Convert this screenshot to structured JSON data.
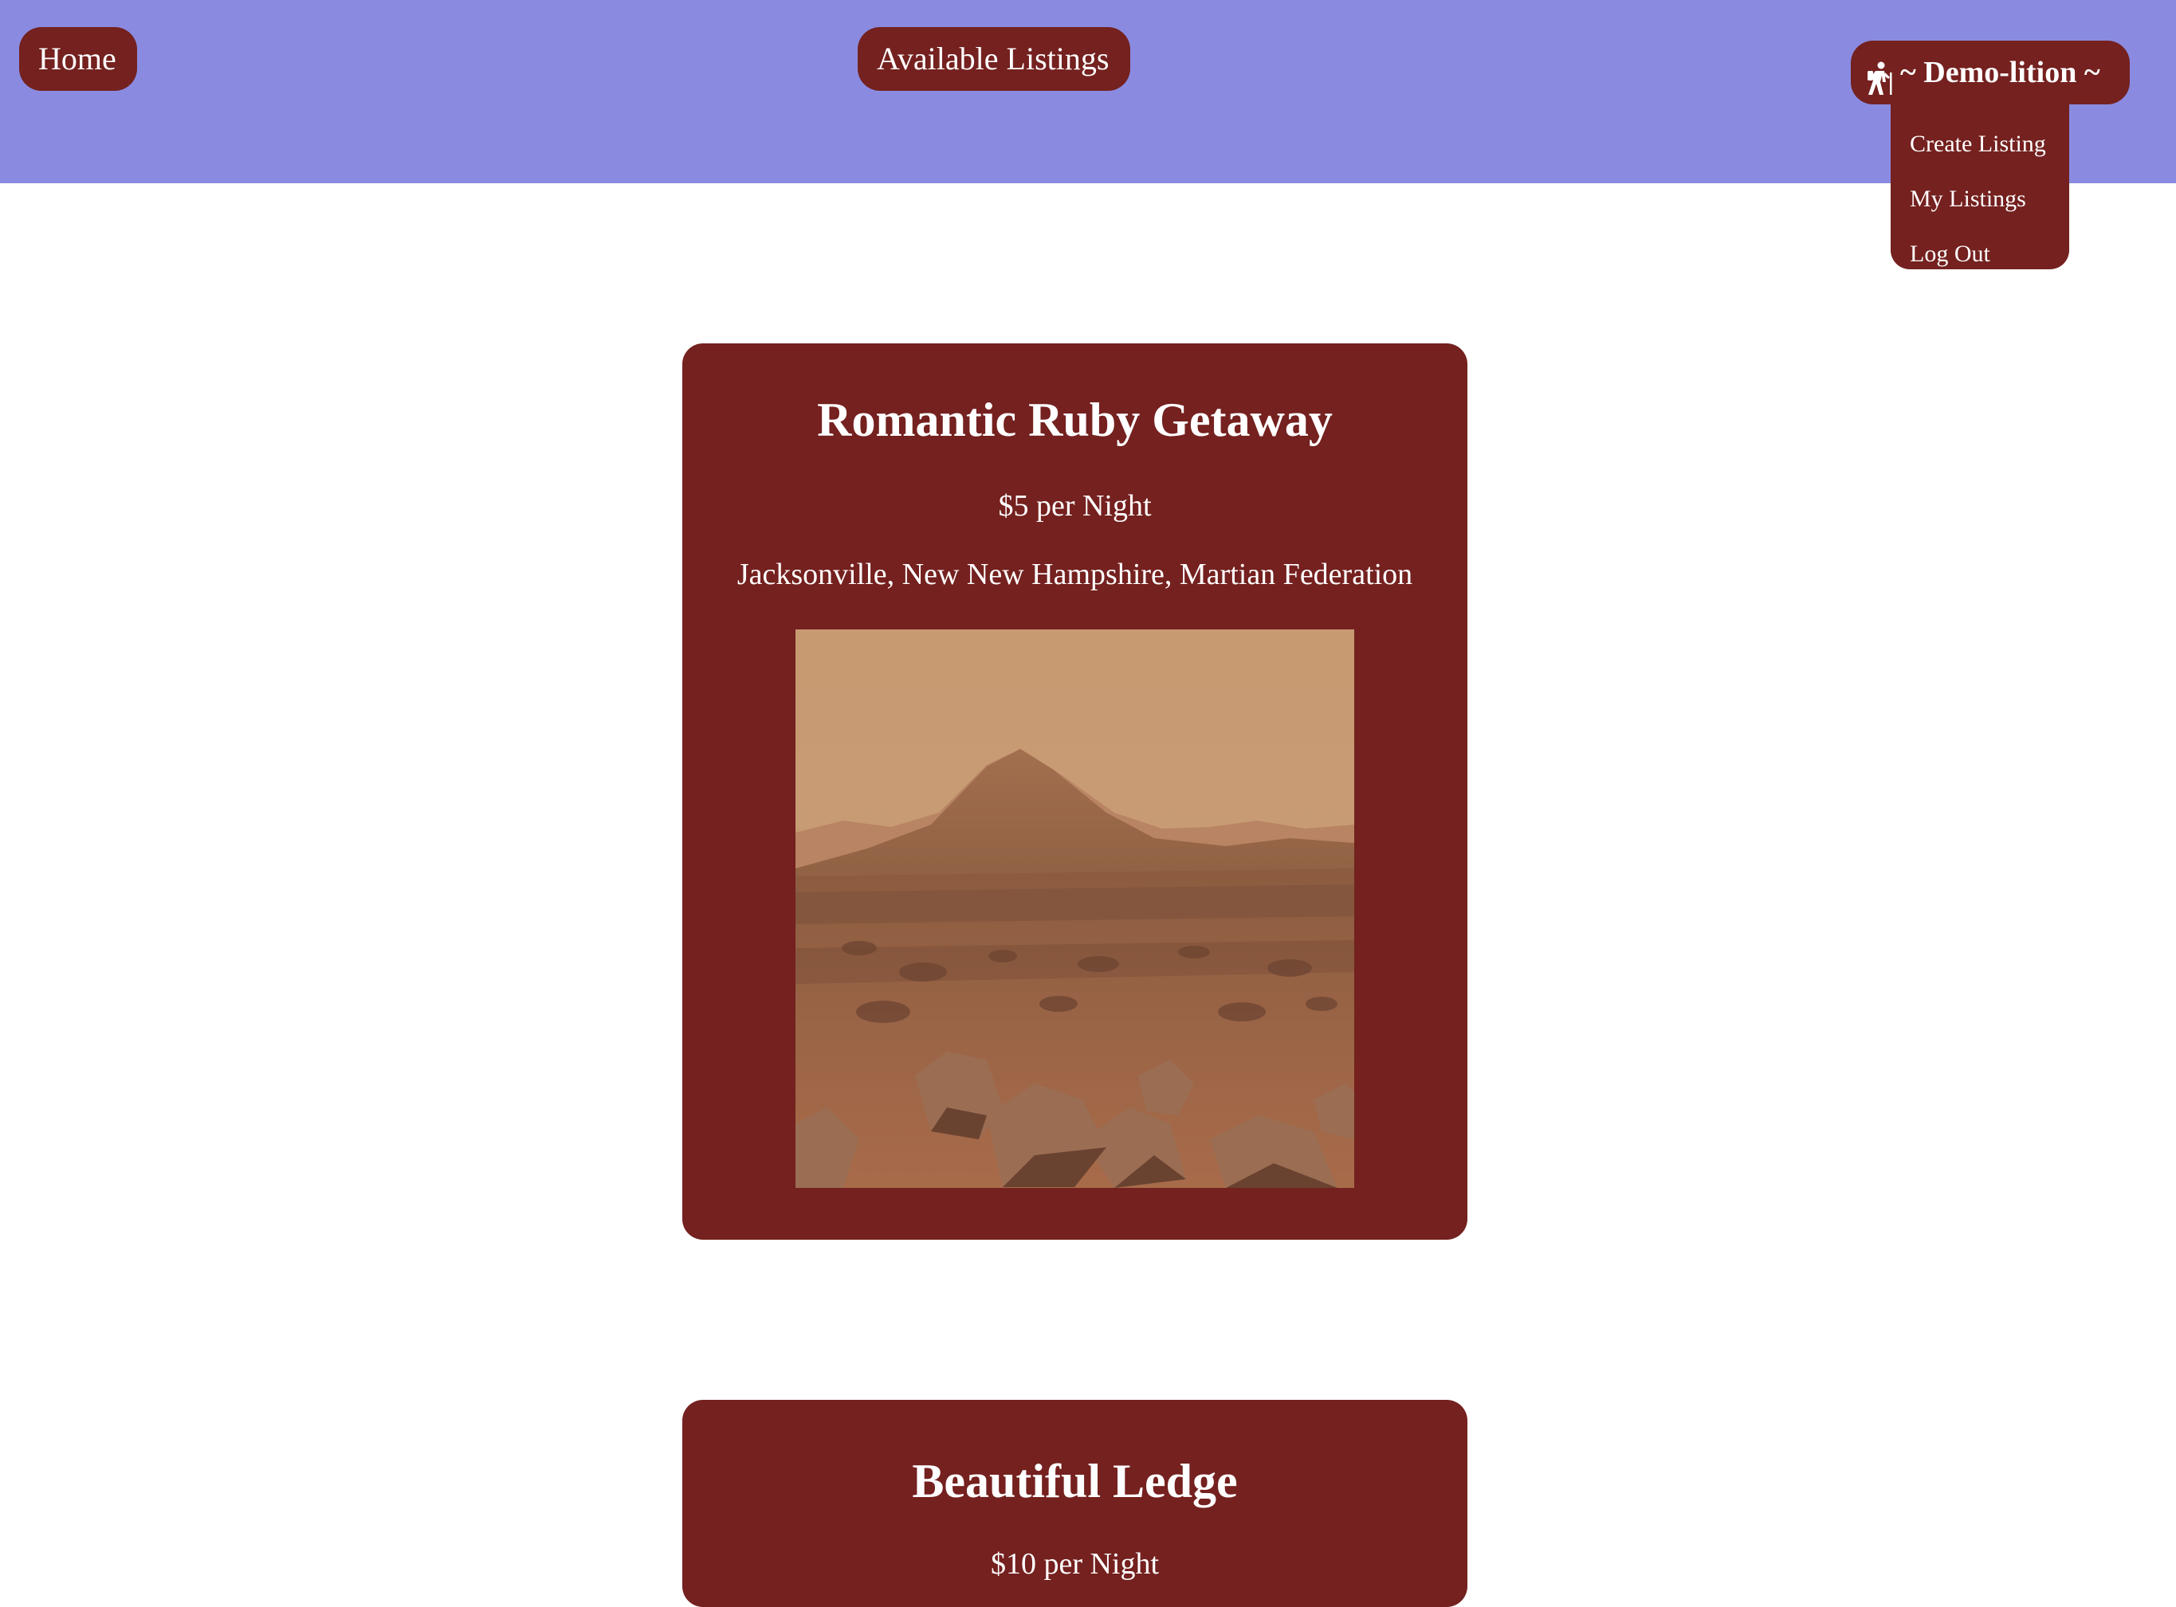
{
  "nav": {
    "home_label": "Home",
    "listings_label": "Available Listings",
    "user_label": "~ Demo-lition ~",
    "user_icon": "hiker-icon"
  },
  "dropdown": {
    "items": [
      "Create Listing",
      "My Listings",
      "Log Out"
    ]
  },
  "listings": [
    {
      "title": "Romantic Ruby Getaway",
      "price": "$5 per Night",
      "location": "Jacksonville, New New Hampshire, Martian Federation",
      "image": "mars-landscape-photo"
    },
    {
      "title": "Beautiful Ledge",
      "price": "$10 per Night"
    }
  ],
  "colors": {
    "header_bg": "#8a8be0",
    "accent": "#74211f",
    "text": "#ffffff"
  }
}
